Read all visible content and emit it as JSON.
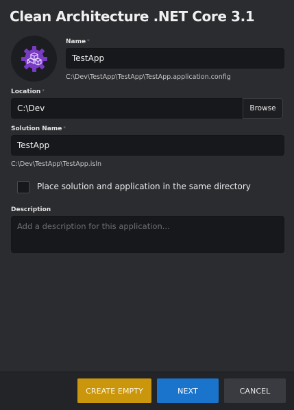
{
  "dialog": {
    "title": "Clean Architecture .NET Core 3.1"
  },
  "app_icon": "purple-gear-cube-icon",
  "name": {
    "label": "Name",
    "required_mark": "*",
    "value": "TestApp",
    "path_hint": "C:\\Dev\\TestApp\\TestApp\\TestApp.application.config"
  },
  "location": {
    "label": "Location",
    "required_mark": "*",
    "value": "C:\\Dev",
    "browse_label": "Browse"
  },
  "solution_name": {
    "label": "Solution Name",
    "required_mark": "*",
    "value": "TestApp",
    "path_hint": "C:\\Dev\\TestApp\\TestApp.isln"
  },
  "same_directory": {
    "label": "Place solution and application in the same directory",
    "checked": false
  },
  "description": {
    "label": "Description",
    "placeholder": "Add a description for this application..."
  },
  "footer": {
    "create_empty_label": "CREATE EMPTY",
    "next_label": "NEXT",
    "cancel_label": "CANCEL"
  },
  "colors": {
    "background": "#2b2c30",
    "input_background": "#17181b",
    "create_empty": "#c9960c",
    "next": "#1a74cc",
    "cancel": "#3a3b40",
    "icon_accent": "#7a3bc4"
  }
}
